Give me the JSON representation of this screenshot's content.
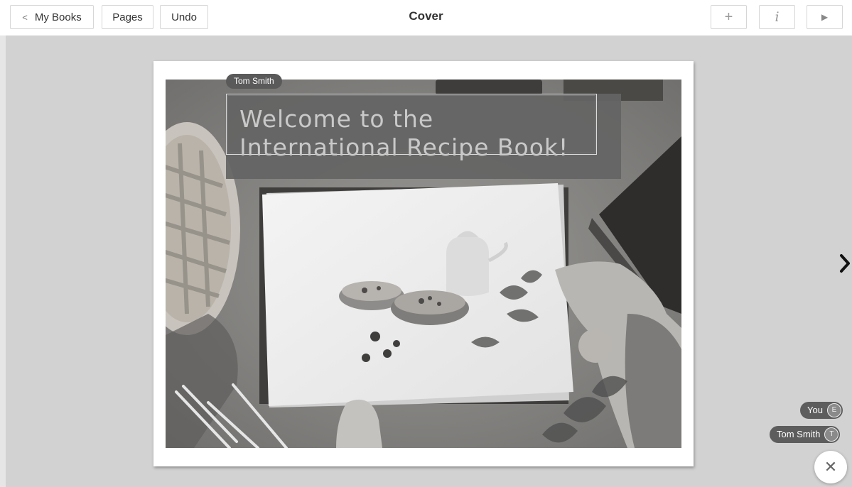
{
  "toolbar": {
    "back_label": "My Books",
    "pages_label": "Pages",
    "undo_label": "Undo",
    "title": "Cover",
    "add_icon": "plus-icon",
    "info_icon": "info-icon",
    "play_icon": "play-icon"
  },
  "cover": {
    "editor_tag": "Tom Smith",
    "title_line1": "Welcome to the",
    "title_line2": "International Recipe Book!"
  },
  "collaborators": [
    {
      "name": "You",
      "initial": "E"
    },
    {
      "name": "Tom Smith",
      "initial": "T"
    }
  ],
  "colors": {
    "canvas": "#d2d2d2",
    "title_overlay": "#646464",
    "pill": "#5d5d5d"
  }
}
